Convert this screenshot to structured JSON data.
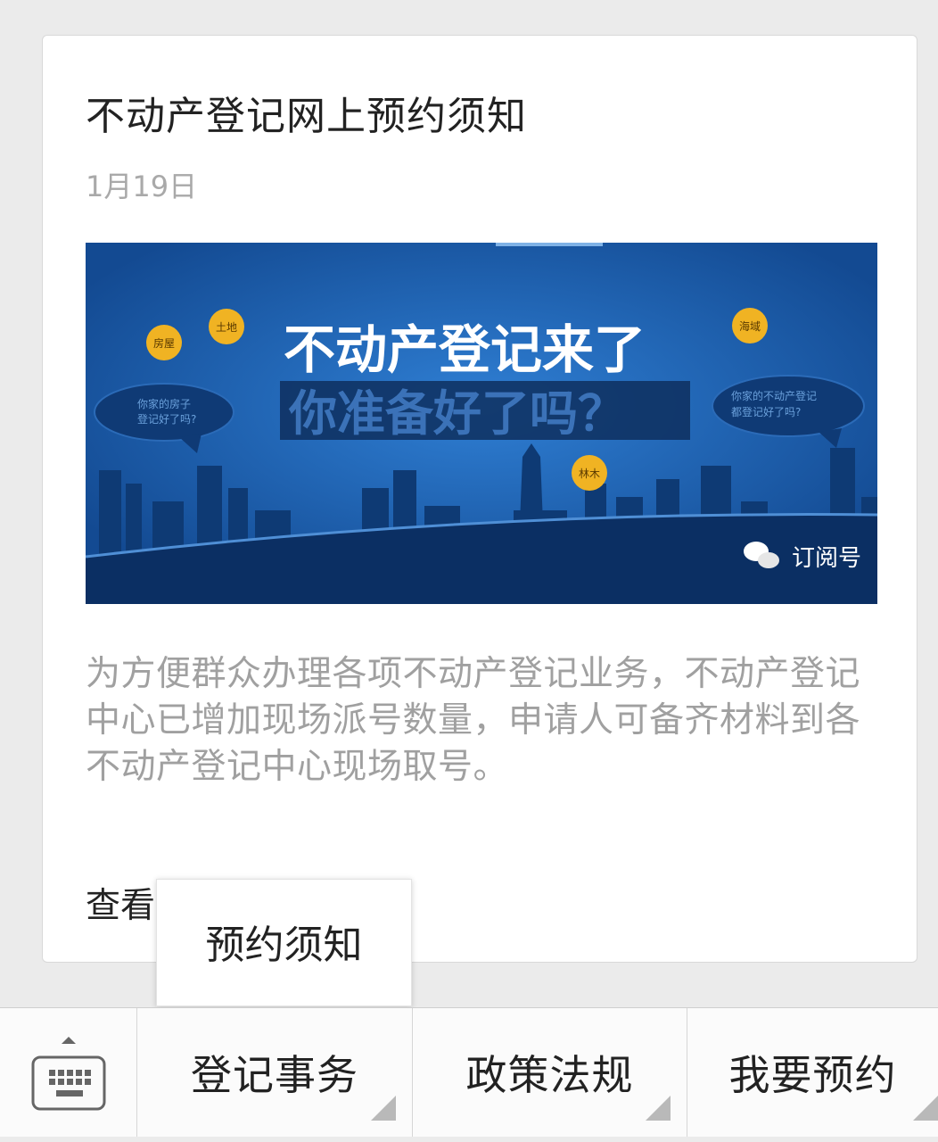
{
  "article": {
    "title": "不动产登记网上预约须知",
    "date": "1月19日",
    "cover": {
      "headline_line1": "不动产登记来了",
      "headline_line2": "你准备好了吗？",
      "tag_house": "房屋",
      "tag_land": "土地",
      "tag_sea": "海域",
      "tag_forest": "林木",
      "bubble_left": "你家的房子\n登记好了吗?",
      "bubble_right": "你家的不动产登记\n都登记好了吗?",
      "watermark": "订阅号"
    },
    "summary": "为方便群众办理各项不动产登记业务，不动产登记中心已增加现场派号数量，申请人可备齐材料到各不动产登记中心现场取号。",
    "read_more_label": "查看"
  },
  "popup_menu": {
    "items": [
      "预约须知"
    ]
  },
  "menu_bar": {
    "keyboard_icon": "keyboard-icon",
    "buttons": [
      {
        "label": "登记事务"
      },
      {
        "label": "政策法规"
      },
      {
        "label": "我要预约"
      }
    ]
  }
}
